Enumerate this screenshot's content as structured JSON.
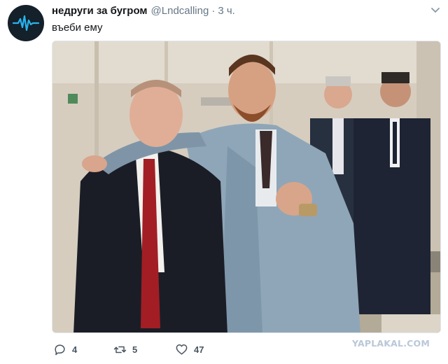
{
  "tweet": {
    "display_name": "недруги за бугром",
    "handle": "@Lndcalling",
    "separator": "·",
    "time": "3 ч.",
    "text": "въеби ему",
    "avatar_icon": "waveform-icon",
    "menu_icon": "chevron-down-icon"
  },
  "actions": {
    "reply": {
      "icon": "reply-icon",
      "count": "4"
    },
    "retweet": {
      "icon": "retweet-icon",
      "count": "5"
    },
    "like": {
      "icon": "heart-icon",
      "count": "47"
    }
  },
  "watermark": "YAPLAKAL.COM",
  "colors": {
    "accent_icon": "#1da1f2",
    "secondary_text": "#657786",
    "avatar_bg": "#14202a"
  }
}
